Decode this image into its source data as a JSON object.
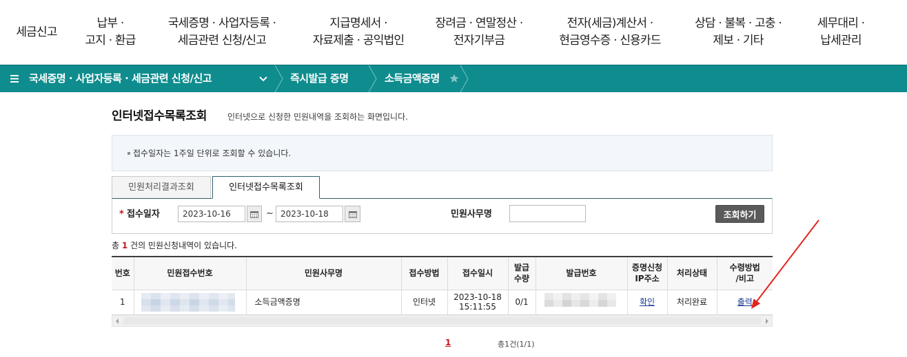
{
  "top_nav": {
    "items": [
      {
        "label": "세금신고"
      },
      {
        "label": "납부 ·\n고지 · 환급"
      },
      {
        "label": "국세증명 · 사업자등록 ·\n세금관련 신청/신고"
      },
      {
        "label": "지급명세서 ·\n자료제출 · 공익법인"
      },
      {
        "label": "장려금 · 연말정산 ·\n전자기부금"
      },
      {
        "label": "전자(세금)계산서 ·\n현금영수증 · 신용카드"
      },
      {
        "label": "상담 · 불복 · 고충 ·\n제보 · 기타"
      },
      {
        "label": "세무대리 ·\n납세관리"
      }
    ]
  },
  "breadcrumb": {
    "menu": "국세증명 · 사업자등록 · 세금관련 신청/신고",
    "items": [
      "즉시발급 증명",
      "소득금액증명"
    ]
  },
  "page": {
    "title": "인터넷접수목록조회",
    "description": "인터넷으로 신청한 민원내역을 조회하는 화면입니다.",
    "notice": "접수일자는 1주일 단위로 조회할 수 있습니다."
  },
  "tabs": [
    {
      "label": "민원처리결과조회",
      "selected": false
    },
    {
      "label": "인터넷접수목록조회",
      "selected": true
    }
  ],
  "search": {
    "required_mark": "*",
    "date_label": "접수일자",
    "start_date": "2023-10-16",
    "range_separator": "~",
    "end_date": "2023-10-18",
    "service_label": "민원사무명",
    "service_value": "",
    "submit_label": "조회하기"
  },
  "summary": {
    "prefix": "총 ",
    "count": "1",
    "suffix": " 건의 민원신청내역이 있습니다."
  },
  "table": {
    "columns": [
      "번호",
      "민원접수번호",
      "민원사무명",
      "접수방법",
      "접수일시",
      "발급\n수량",
      "발급번호",
      "증명신청\nIP주소",
      "처리상태",
      "수령방법\n/비고"
    ],
    "rows": [
      {
        "no": "1",
        "service": "소득금액증명",
        "method": "인터넷",
        "received_at": "2023-10-18\n15:11:55",
        "issued": "0/1",
        "ip_link": "확인",
        "status": "처리완료",
        "receive_link": "출력"
      }
    ]
  },
  "pagination": {
    "current_page": "1",
    "total": "총1건(1/1)"
  },
  "icons": {
    "menu": "hamburger-icon",
    "dropdown": "chevron-down-icon",
    "favorite": "star-icon",
    "calendar": "calendar-icon",
    "notice_bullet": "square-bullet-icon",
    "scroll_left": "triangle-left-icon",
    "scroll_right": "triangle-right-icon"
  },
  "colors": {
    "brand_teal": "#0e8c8e",
    "accent_red": "#c4161c",
    "link_blue": "#1b3d96",
    "button_dark": "#5a5a5a",
    "annotation_red": "#e3221c"
  }
}
